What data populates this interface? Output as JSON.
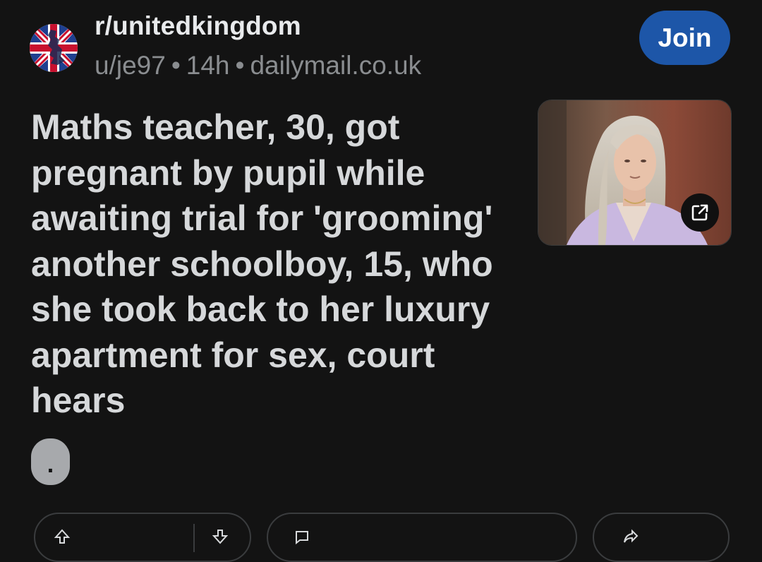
{
  "header": {
    "subreddit": "r/unitedkingdom",
    "user": "u/je97",
    "age": "14h",
    "domain": "dailymail.co.uk",
    "separator": "•",
    "join_label": "Join",
    "avatar_icon": "union-jack-uk-map-icon"
  },
  "post": {
    "title": "Maths teacher, 30, got pregnant by pupil while awaiting trial for 'grooming' another schoolboy, 15, who she took back to her luxury apartment for sex, court hears",
    "thumbnail_icon": "article-thumbnail-photo",
    "external_link_icon": "external-link-icon",
    "flair_text": "."
  },
  "actions": {
    "vote_icon": "upvote-icon",
    "downvote_icon": "downvote-icon",
    "comment_icon": "comment-icon",
    "share_icon": "share-icon"
  },
  "colors": {
    "background": "#131313",
    "join_button": "#1d56a8",
    "title_text": "#d6d8da",
    "meta_text": "#8a8d90",
    "flair": "#a7a9ac"
  }
}
